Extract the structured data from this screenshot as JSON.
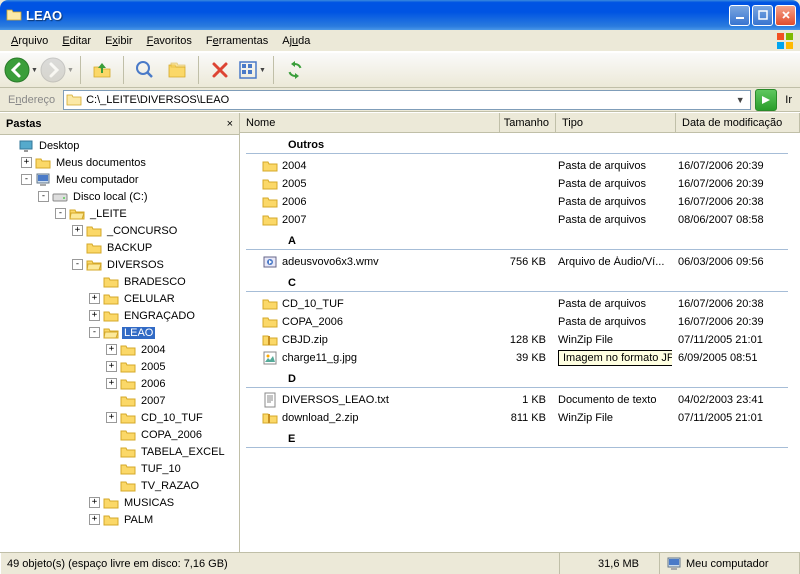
{
  "window": {
    "title": "LEAO"
  },
  "menu": {
    "arquivo": "Arquivo",
    "editar": "Editar",
    "exibir": "Exibir",
    "favoritos": "Favoritos",
    "ferramentas": "Ferramentas",
    "ajuda": "Ajuda"
  },
  "address": {
    "label": "Endereço",
    "path": "C:\\_LEITE\\DIVERSOS\\LEAO",
    "go": "Ir"
  },
  "panel": {
    "title": "Pastas"
  },
  "tree": [
    {
      "d": 0,
      "e": "",
      "icon": "desktop",
      "label": "Desktop"
    },
    {
      "d": 1,
      "e": "+",
      "icon": "folder",
      "label": "Meus documentos"
    },
    {
      "d": 1,
      "e": "-",
      "icon": "computer",
      "label": "Meu computador"
    },
    {
      "d": 2,
      "e": "-",
      "icon": "drive",
      "label": "Disco local (C:)"
    },
    {
      "d": 3,
      "e": "-",
      "icon": "folder-o",
      "label": "_LEITE"
    },
    {
      "d": 4,
      "e": "+",
      "icon": "folder",
      "label": "_CONCURSO"
    },
    {
      "d": 4,
      "e": "",
      "icon": "folder",
      "label": "BACKUP"
    },
    {
      "d": 4,
      "e": "-",
      "icon": "folder-o",
      "label": "DIVERSOS"
    },
    {
      "d": 5,
      "e": "",
      "icon": "folder",
      "label": "BRADESCO"
    },
    {
      "d": 5,
      "e": "+",
      "icon": "folder",
      "label": "CELULAR"
    },
    {
      "d": 5,
      "e": "+",
      "icon": "folder",
      "label": "ENGRAÇADO"
    },
    {
      "d": 5,
      "e": "-",
      "icon": "folder-o",
      "label": "LEAO",
      "sel": true
    },
    {
      "d": 6,
      "e": "+",
      "icon": "folder",
      "label": "2004"
    },
    {
      "d": 6,
      "e": "+",
      "icon": "folder",
      "label": "2005"
    },
    {
      "d": 6,
      "e": "+",
      "icon": "folder",
      "label": "2006"
    },
    {
      "d": 6,
      "e": "",
      "icon": "folder",
      "label": "2007"
    },
    {
      "d": 6,
      "e": "+",
      "icon": "folder",
      "label": "CD_10_TUF"
    },
    {
      "d": 6,
      "e": "",
      "icon": "folder",
      "label": "COPA_2006"
    },
    {
      "d": 6,
      "e": "",
      "icon": "folder",
      "label": "TABELA_EXCEL"
    },
    {
      "d": 6,
      "e": "",
      "icon": "folder",
      "label": "TUF_10"
    },
    {
      "d": 6,
      "e": "",
      "icon": "folder",
      "label": "TV_RAZAO"
    },
    {
      "d": 5,
      "e": "+",
      "icon": "folder",
      "label": "MUSICAS"
    },
    {
      "d": 5,
      "e": "+",
      "icon": "folder",
      "label": "PALM"
    }
  ],
  "columns": {
    "nome": "Nome",
    "tamanho": "Tamanho",
    "tipo": "Tipo",
    "data": "Data de modificação"
  },
  "groups": [
    {
      "title": "Outros",
      "items": [
        {
          "icon": "folder",
          "name": "2004",
          "size": "",
          "type": "Pasta de arquivos",
          "date": "16/07/2006 20:39"
        },
        {
          "icon": "folder",
          "name": "2005",
          "size": "",
          "type": "Pasta de arquivos",
          "date": "16/07/2006 20:39"
        },
        {
          "icon": "folder",
          "name": "2006",
          "size": "",
          "type": "Pasta de arquivos",
          "date": "16/07/2006 20:38"
        },
        {
          "icon": "folder",
          "name": "2007",
          "size": "",
          "type": "Pasta de arquivos",
          "date": "08/06/2007 08:58"
        }
      ]
    },
    {
      "title": "A",
      "items": [
        {
          "icon": "wmv",
          "name": "adeusvovo6x3.wmv",
          "size": "756 KB",
          "type": "Arquivo de Áudio/Ví...",
          "date": "06/03/2006 09:56"
        }
      ]
    },
    {
      "title": "C",
      "items": [
        {
          "icon": "folder",
          "name": "CD_10_TUF",
          "size": "",
          "type": "Pasta de arquivos",
          "date": "16/07/2006 20:38"
        },
        {
          "icon": "folder",
          "name": "COPA_2006",
          "size": "",
          "type": "Pasta de arquivos",
          "date": "16/07/2006 20:39"
        },
        {
          "icon": "zip",
          "name": "CBJD.zip",
          "size": "128 KB",
          "type": "WinZip File",
          "date": "07/11/2005 21:01"
        },
        {
          "icon": "jpg",
          "name": "charge11_g.jpg",
          "size": "39 KB",
          "type": "Imagem no formato ...",
          "date": "6/09/2005 08:51",
          "tooltip": "Imagem no formato JPEG"
        }
      ]
    },
    {
      "title": "D",
      "items": [
        {
          "icon": "txt",
          "name": "DIVERSOS_LEAO.txt",
          "size": "1 KB",
          "type": "Documento de texto",
          "date": "04/02/2003 23:41"
        },
        {
          "icon": "zip",
          "name": "download_2.zip",
          "size": "811 KB",
          "type": "WinZip File",
          "date": "07/11/2005 21:01"
        }
      ]
    },
    {
      "title": "E",
      "items": []
    }
  ],
  "status": {
    "objects": "49 objeto(s) (espaço livre em disco: 7,16 GB)",
    "size": "31,6 MB",
    "location": "Meu computador"
  }
}
